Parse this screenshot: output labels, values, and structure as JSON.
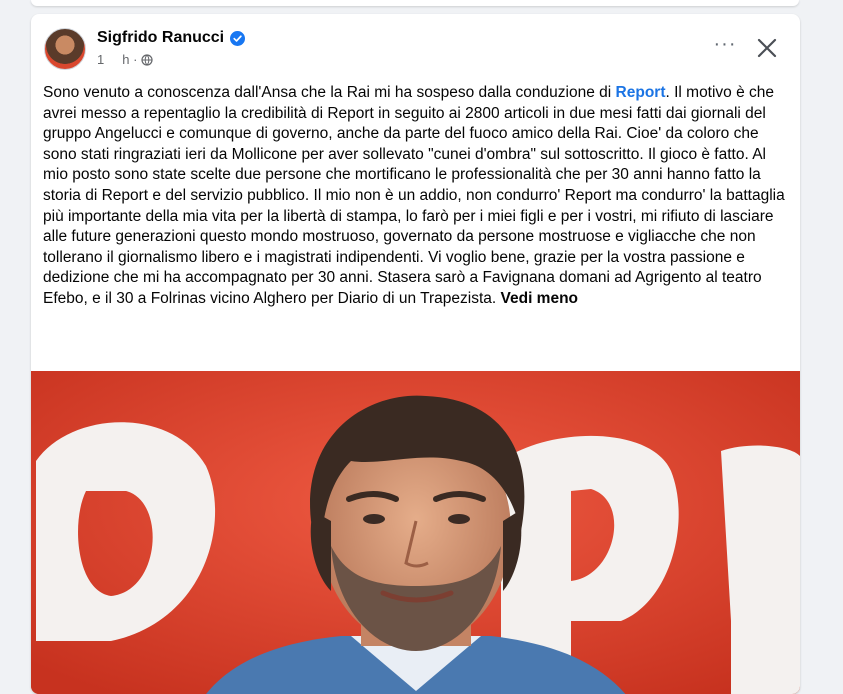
{
  "post": {
    "author_name": "Sigfrido Ranucci",
    "time_prefix": "1",
    "time_unit": "h ·",
    "text_before_link": "Sono venuto a conoscenza dall'Ansa che la Rai mi ha sospeso dalla conduzione di ",
    "link_text": "Report",
    "text_after_link": ". Il motivo è che avrei messo a repentaglio la credibilità di Report  in seguito ai 2800 articoli in due mesi fatti dai giornali del gruppo Angelucci e comunque di governo, anche da parte del fuoco amico della Rai. Cioe' da coloro che sono stati ringraziati ieri da Mollicone per aver sollevato \"cunei d'ombra\" sul sottoscritto. Il gioco è fatto. Al mio posto sono state scelte due persone che mortificano le professionalità che per 30 anni hanno fatto la storia di Report e del servizio pubblico. Il mio non è un addio, non condurro'  Report ma condurro' la battaglia più importante della mia vita per la libertà di stampa, lo farò per i miei figli e per i vostri, mi rifiuto di lasciare alle future generazioni questo mondo mostruoso, governato da persone mostruose e vigliacche che non tollerano il giornalismo libero e i magistrati indipendenti. Vi voglio bene, grazie per la vostra passione e dedizione che mi ha accompagnato per 30 anni. Stasera sarò a Favignana domani ad Agrigento al teatro Efebo, e il 30 a Folrinas vicino Alghero per Diario di un Trapezista. ",
    "see_less_label": "Vedi meno"
  },
  "actions": {
    "more_label": "···"
  },
  "icons": {
    "verified": "verified-badge-icon",
    "audience": "globe-icon",
    "more": "more-options-icon",
    "close": "close-icon"
  },
  "colors": {
    "link": "#1b74e4",
    "verified": "#1877f2",
    "background": "#f0f2f5",
    "photo_backdrop": "#dd4733"
  }
}
